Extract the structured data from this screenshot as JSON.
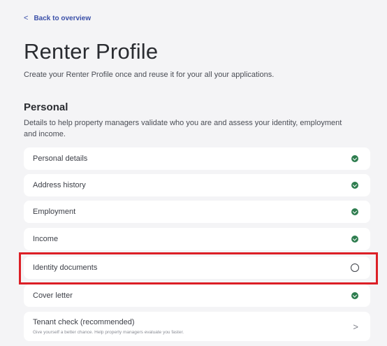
{
  "nav": {
    "back_label": "Back to overview",
    "back_icon": "chevron-left-icon"
  },
  "header": {
    "title": "Renter Profile",
    "subtitle": "Create your Renter Profile once and reuse it for your all your applications."
  },
  "section": {
    "title": "Personal",
    "description": "Details to help property managers validate who you are and assess your identity, employment and income."
  },
  "items": [
    {
      "label": "Personal details",
      "status": "complete"
    },
    {
      "label": "Address history",
      "status": "complete"
    },
    {
      "label": "Employment",
      "status": "complete"
    },
    {
      "label": "Income",
      "status": "complete"
    },
    {
      "label": "Identity documents",
      "status": "incomplete"
    },
    {
      "label": "Cover letter",
      "status": "complete"
    }
  ],
  "tenant_check": {
    "label": "Tenant check (recommended)",
    "hint": "Give yourself a better chance. Help property managers evaluate you faster.",
    "icon": "chevron-right-icon"
  },
  "colors": {
    "accent": "#3a4fa8",
    "complete": "#2e7d4f",
    "highlight": "#dc1f26",
    "card": "#ffffff",
    "background": "#f4f4f6"
  }
}
